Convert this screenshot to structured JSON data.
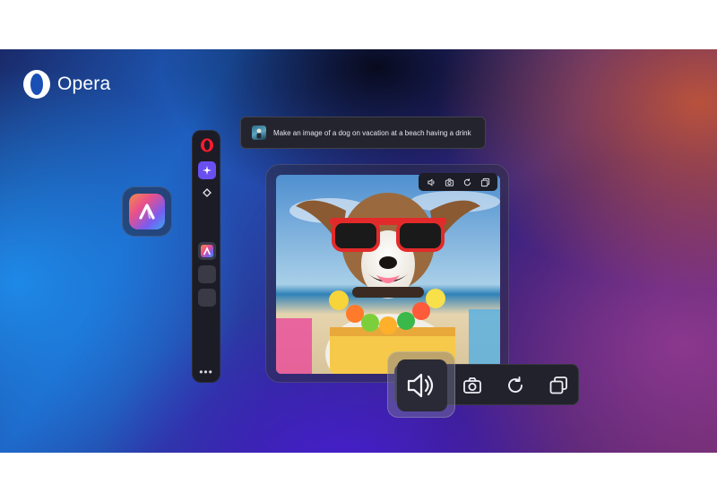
{
  "brand": {
    "name": "Opera"
  },
  "prompt": {
    "text": "Make an image of a dog on vacation at a beach having a drink"
  },
  "sidebar": {
    "items": [
      {
        "icon": "opera-icon"
      },
      {
        "icon": "aria-sparkle-icon"
      },
      {
        "icon": "diamond-icon"
      },
      {
        "icon": "ai-app-icon"
      },
      {
        "icon": "empty-slot"
      },
      {
        "icon": "empty-slot"
      }
    ],
    "more_label": "•••"
  },
  "image_toolbar": {
    "buttons": [
      "speaker-icon",
      "camera-icon",
      "refresh-icon",
      "copy-icon"
    ]
  },
  "colors": {
    "accent": "#6a4ff0",
    "opera_red": "#ff1b2d",
    "panel": "#1c1c26"
  }
}
